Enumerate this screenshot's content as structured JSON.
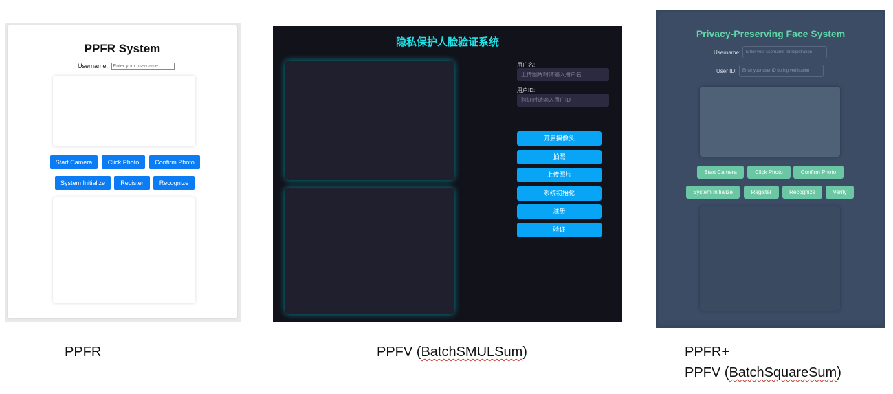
{
  "ppfr": {
    "title": "PPFR System",
    "username_label": "Username:",
    "username_placeholder": "Enter your username",
    "buttons": {
      "start_camera": "Start Camera",
      "click_photo": "Click Photo",
      "confirm_photo": "Confirm Photo",
      "system_initialize": "System Initialize",
      "register": "Register",
      "recognize": "Recognize"
    }
  },
  "ppfv": {
    "title": "隐私保护人脸验证系统",
    "username_label": "用户名:",
    "username_placeholder": "上传图片时请输入用户名",
    "userid_label": "用户ID:",
    "userid_placeholder": "验证时请输入用户ID",
    "buttons": {
      "open_camera": "开启摄像头",
      "take_photo": "拍照",
      "upload_photo": "上传照片",
      "system_init": "系统初始化",
      "register": "注册",
      "verify": "验证"
    }
  },
  "ppfr_plus": {
    "title": "Privacy-Preserving Face System",
    "username_label": "Username:",
    "username_placeholder": "Enter your username for registration",
    "userid_label": "User ID:",
    "userid_placeholder": "Enter your user ID during verification",
    "buttons": {
      "start_camera": "Start Camera",
      "click_photo": "Click Photo",
      "confirm_photo": "Confirm Photo",
      "system_initialize": "System Initialize",
      "register": "Register",
      "recognize": "Recognize",
      "verify": "Verify"
    }
  },
  "captions": {
    "ppfr": "PPFR",
    "ppfv_prefix": "PPFV (",
    "ppfv_method": "BatchSMULSum",
    "ppfv_suffix": ")",
    "plus_line1": "PPFR+",
    "plus_line2_prefix": "PPFV (",
    "plus_method": "BatchSquareSum",
    "plus_line2_suffix": ")"
  },
  "colors": {
    "ppfr_button": "#0b7cf4",
    "ppfv_background": "#12121b",
    "ppfv_title": "#1ee3e8",
    "ppfv_button": "#08a4f6",
    "ppfr_plus_background": "#36475e",
    "ppfr_plus_title": "#5fd6a8",
    "ppfr_plus_button": "#6bc6a3"
  }
}
